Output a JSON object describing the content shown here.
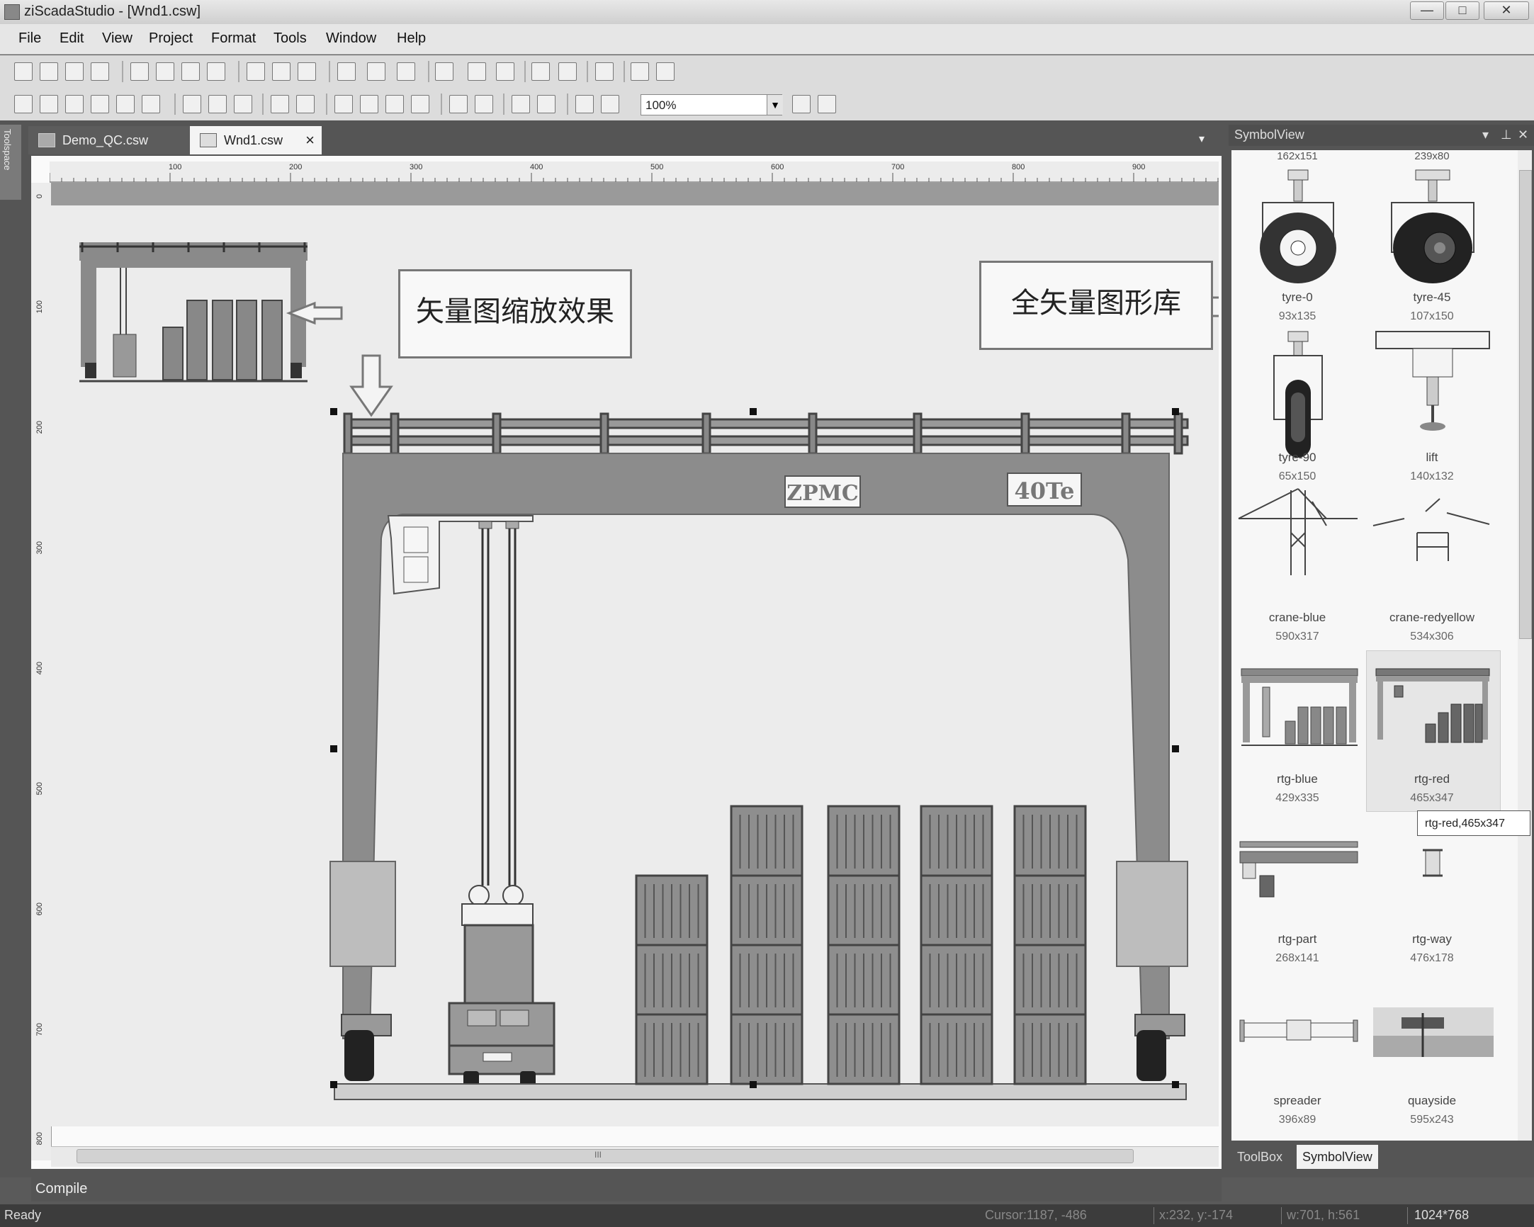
{
  "window": {
    "title": "ziScadaStudio - [Wnd1.csw]",
    "controls": [
      "—",
      "□",
      "✕"
    ]
  },
  "menu": [
    "File",
    "Edit",
    "View",
    "Project",
    "Format",
    "Tools",
    "Window",
    "Help"
  ],
  "toolbar": {
    "zoom": "100%"
  },
  "side_strip": "Toolspace",
  "tabs": [
    {
      "label": "Demo_QC.csw",
      "active": false
    },
    {
      "label": "Wnd1.csw",
      "active": true
    }
  ],
  "tab_close": "×",
  "tab_dropdown": "▾",
  "ruler": {
    "h": [
      "100",
      "200",
      "300",
      "400",
      "500",
      "600",
      "700",
      "800",
      "900"
    ],
    "v": [
      "0",
      "100",
      "200",
      "300",
      "400",
      "500",
      "600",
      "700",
      "800"
    ]
  },
  "canvas": {
    "callout_zoom": "矢量图缩放效果",
    "callout_library": "全矢量图形库",
    "crane_label_brand": "ZPMC",
    "crane_label_capacity": "40Te"
  },
  "scrollbar_grip": "III",
  "compile_label": "Compile",
  "status": {
    "ready": "Ready",
    "cursor": "Cursor:1187, -486",
    "pos": "x:232, y:-174",
    "size": "w:701, h:561",
    "resolution": "1024*768"
  },
  "panel": {
    "title": "SymbolView",
    "buttons": [
      "▾",
      "⊥",
      "✕"
    ],
    "top_sizes": [
      "162x151",
      "239x80"
    ],
    "symbols": [
      {
        "name": "tyre-0",
        "size": "93x135"
      },
      {
        "name": "tyre-45",
        "size": "107x150"
      },
      {
        "name": "tyre-90",
        "size": "65x150"
      },
      {
        "name": "lift",
        "size": "140x132"
      },
      {
        "name": "crane-blue",
        "size": "590x317"
      },
      {
        "name": "crane-redyellow",
        "size": "534x306"
      },
      {
        "name": "rtg-blue",
        "size": "429x335"
      },
      {
        "name": "rtg-red",
        "size": "465x347"
      },
      {
        "name": "rtg-part",
        "size": "268x141"
      },
      {
        "name": "rtg-way",
        "size": "476x178"
      },
      {
        "name": "spreader",
        "size": "396x89"
      },
      {
        "name": "quayside",
        "size": "595x243"
      }
    ],
    "tooltip": "rtg-red,465x347",
    "tabs": [
      "ToolBox",
      "SymbolView"
    ]
  }
}
